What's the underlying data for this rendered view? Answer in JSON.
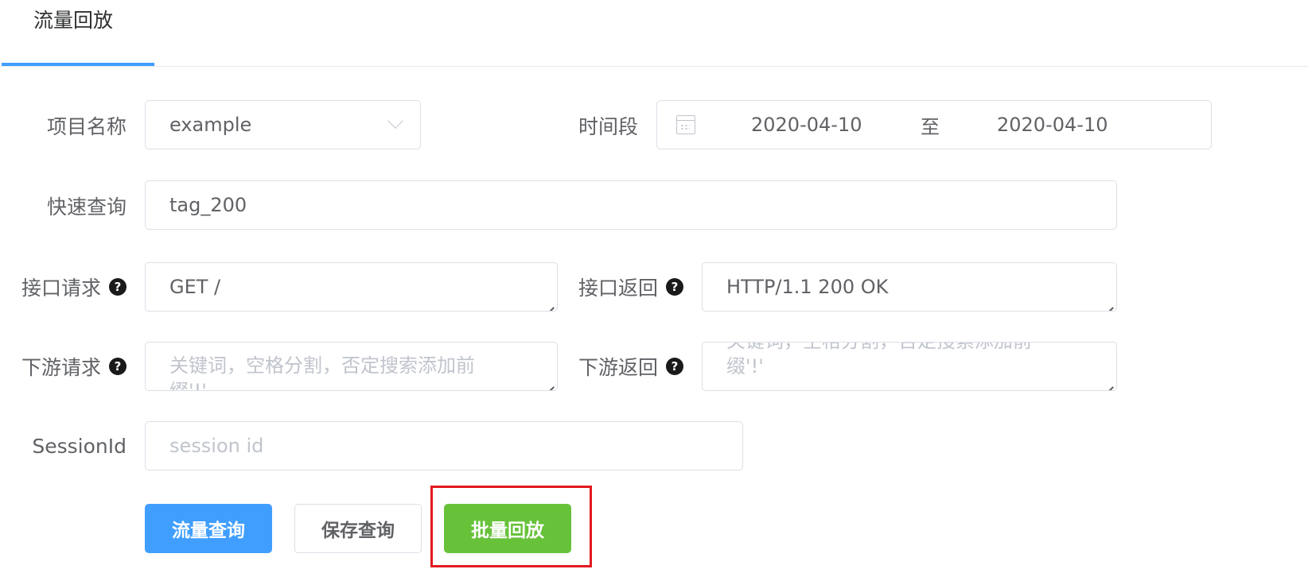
{
  "tabs": [
    {
      "label": "流量回放",
      "active": true
    }
  ],
  "form": {
    "project": {
      "label": "项目名称",
      "value": "example"
    },
    "time_range": {
      "label": "时间段",
      "start": "2020-04-10",
      "separator": "至",
      "end": "2020-04-10"
    },
    "quick_query": {
      "label": "快速查询",
      "value": "tag_200"
    },
    "api_request": {
      "label": "接口请求",
      "value": "GET /"
    },
    "api_response": {
      "label": "接口返回",
      "value": "HTTP/1.1 200 OK"
    },
    "downstream_request": {
      "label": "下游请求",
      "placeholder": "关键词，空格分割，否定搜索添加前缀'!'"
    },
    "downstream_response": {
      "label": "下游返回",
      "placeholder": "关键词，空格分割，否定搜索添加前缀'!'"
    },
    "session_id": {
      "label": "SessionId",
      "placeholder": "session id"
    }
  },
  "buttons": {
    "traffic_query": "流量查询",
    "save_query": "保存查询",
    "batch_replay": "批量回放"
  },
  "icons": {
    "help": "?",
    "help_icon_name": "question-circle-icon",
    "calendar_icon_name": "calendar-icon",
    "dropdown_icon_name": "chevron-down-icon"
  },
  "colors": {
    "primary": "#409eff",
    "success": "#67c23a",
    "highlight": "#e3191f"
  }
}
